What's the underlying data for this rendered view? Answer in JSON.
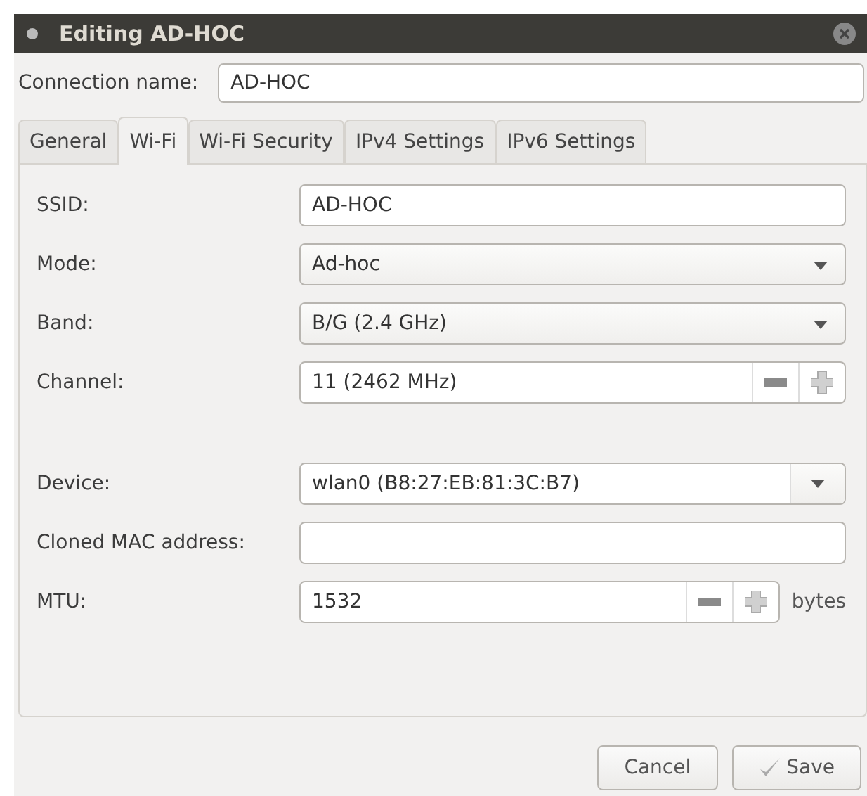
{
  "window": {
    "title": "Editing AD-HOC"
  },
  "connection_name": {
    "label": "Connection name:",
    "value": "AD-HOC"
  },
  "tabs": [
    {
      "label": "General",
      "selected": false
    },
    {
      "label": "Wi-Fi",
      "selected": true
    },
    {
      "label": "Wi-Fi Security",
      "selected": false
    },
    {
      "label": "IPv4 Settings",
      "selected": false
    },
    {
      "label": "IPv6 Settings",
      "selected": false
    }
  ],
  "fields": [
    {
      "kind": "entry",
      "label": "SSID:",
      "value": "AD-HOC"
    },
    {
      "kind": "combo",
      "label": "Mode:",
      "value": "Ad-hoc"
    },
    {
      "kind": "combo",
      "label": "Band:",
      "value": "B/G (2.4 GHz)"
    },
    {
      "kind": "spin",
      "label": "Channel:",
      "value": "11 (2462 MHz)"
    },
    {
      "kind": "gap"
    },
    {
      "kind": "combo-entry",
      "label": "Device:",
      "value": "wlan0 (B8:27:EB:81:3C:B7)"
    },
    {
      "kind": "entry",
      "label": "Cloned MAC address:"
    },
    {
      "kind": "spin",
      "label": "MTU:",
      "value": "1532",
      "unit": "bytes"
    }
  ],
  "buttons": [
    {
      "kind": "cancel",
      "label": "Cancel"
    },
    {
      "kind": "save",
      "label": "Save"
    }
  ]
}
